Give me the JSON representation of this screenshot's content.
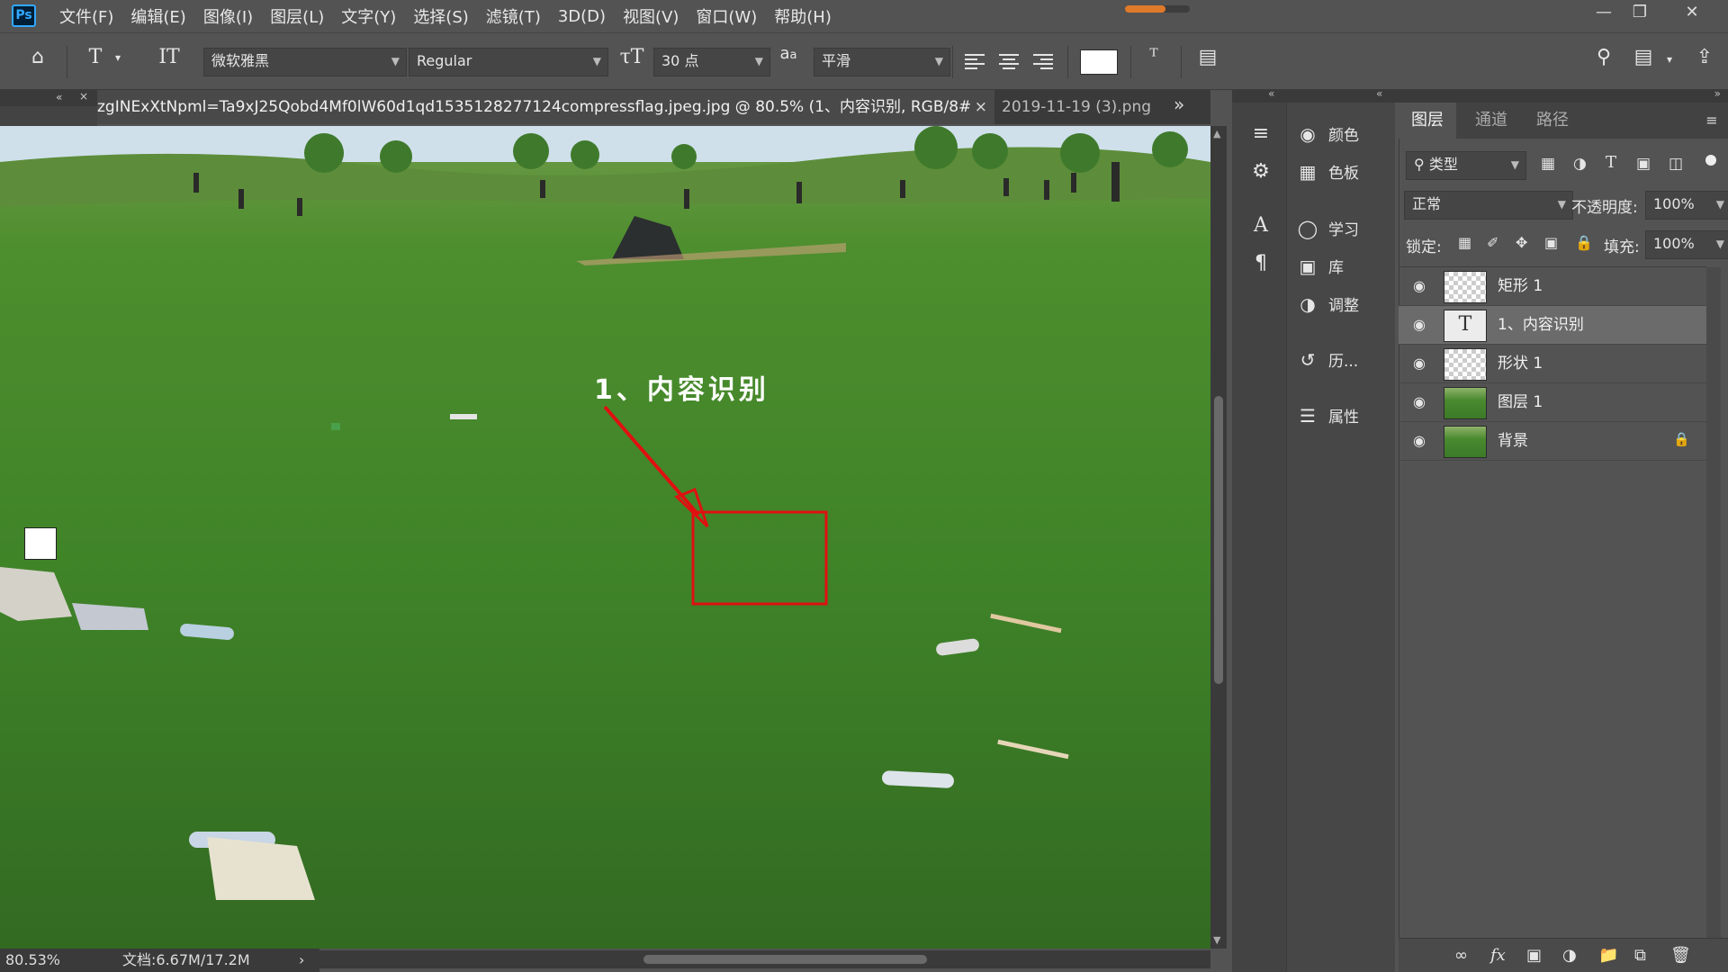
{
  "app": {
    "logo": "Ps"
  },
  "menu": [
    "文件(F)",
    "编辑(E)",
    "图像(I)",
    "图层(L)",
    "文字(Y)",
    "选择(S)",
    "滤镜(T)",
    "3D(D)",
    "视图(V)",
    "窗口(W)",
    "帮助(H)"
  ],
  "progress": {
    "value": 0.62,
    "color": "#e07a2b"
  },
  "options": {
    "font_family": "微软雅黑",
    "font_style": "Regular",
    "font_size": "30 点",
    "aa_label": "a",
    "aa_sub": "a",
    "antialias": "平滑",
    "text_color": "#ffffff"
  },
  "tabs": [
    {
      "label": "zgINExXtNpml=Ta9xJ25Qobd4Mf0lW60d1qd1535128277124compressflag.jpeg.jpg @ 80.5% (1、内容识别, RGB/8#) *",
      "close": "×"
    },
    {
      "label": "2019-11-19 (3).png"
    }
  ],
  "canvas": {
    "annotation_text": "1、内容识别",
    "annotation_color": "#ffffff",
    "box_color": "#e01010"
  },
  "status": {
    "zoom": "80.53%",
    "doc": "文档:6.67M/17.2M",
    "arrow": "›"
  },
  "dock_panels": [
    {
      "label": "颜色",
      "icon": "palette-icon"
    },
    {
      "label": "色板",
      "icon": "swatches-icon"
    },
    {
      "label": "学习",
      "icon": "lightbulb-icon"
    },
    {
      "label": "库",
      "icon": "library-icon"
    },
    {
      "label": "调整",
      "icon": "adjustments-icon"
    },
    {
      "label": "历...",
      "icon": "history-icon"
    },
    {
      "label": "属性",
      "icon": "properties-icon"
    }
  ],
  "layers_panel": {
    "tabs": [
      "图层",
      "通道",
      "路径"
    ],
    "filter_label": "类型",
    "blend_mode": "正常",
    "opacity_label": "不透明度:",
    "opacity": "100%",
    "lock_label": "锁定:",
    "fill_label": "填充:",
    "fill": "100%",
    "layers": [
      {
        "name": "矩形 1",
        "thumb": "shape",
        "selected": false,
        "locked": false
      },
      {
        "name": "1、内容识别",
        "thumb": "text",
        "selected": true,
        "locked": false
      },
      {
        "name": "形状 1",
        "thumb": "shape",
        "selected": false,
        "locked": false
      },
      {
        "name": "图层 1",
        "thumb": "image",
        "selected": false,
        "locked": false
      },
      {
        "name": "背景",
        "thumb": "image",
        "selected": false,
        "locked": true
      }
    ]
  }
}
